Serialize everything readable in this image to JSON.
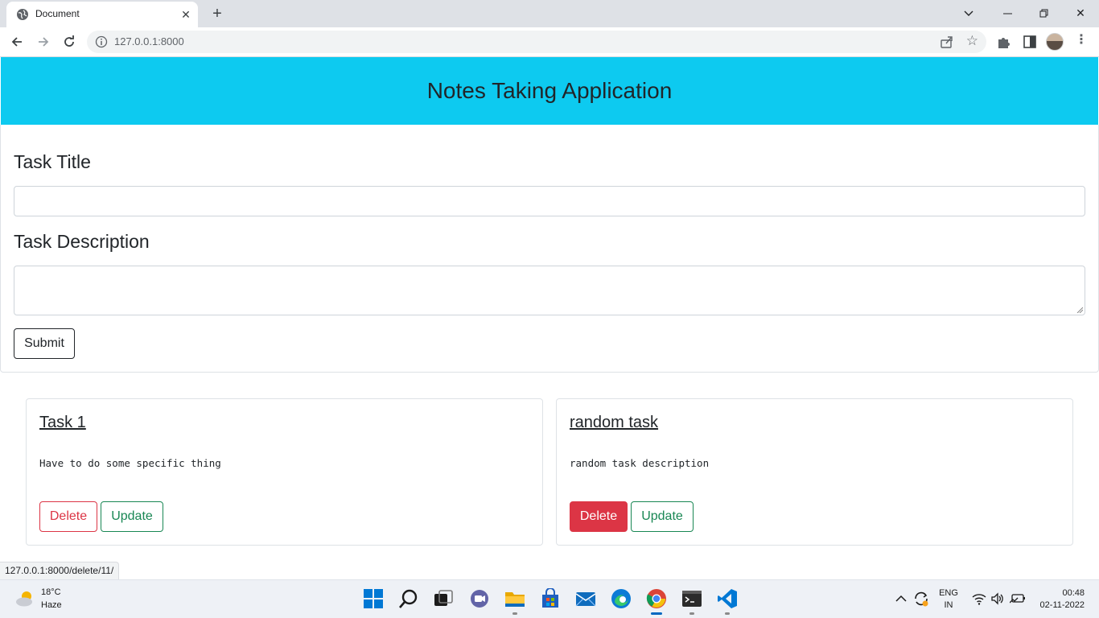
{
  "browser": {
    "tab_title": "Document",
    "url": "127.0.0.1:8000",
    "window_controls": [
      "chevron-down-icon",
      "minimize-icon",
      "restore-icon",
      "close-icon"
    ]
  },
  "page": {
    "header_title": "Notes Taking Application",
    "form": {
      "title_label": "Task Title",
      "title_value": "",
      "description_label": "Task Description",
      "description_value": "",
      "submit_label": "Submit"
    },
    "notes": [
      {
        "title": "Task 1",
        "description": "Have to do some specific thing",
        "delete_label": "Delete",
        "update_label": "Update",
        "delete_style": "outline"
      },
      {
        "title": "random task",
        "description": "random task description",
        "delete_label": "Delete",
        "update_label": "Update",
        "delete_style": "solid-hover"
      }
    ],
    "colors": {
      "header_bg": "#0dcaf0",
      "danger": "#dc3545",
      "success": "#198754"
    }
  },
  "status_bar": {
    "link": "127.0.0.1:8000/delete/11/"
  },
  "taskbar": {
    "weather_temp": "18°C",
    "weather_condition": "Haze",
    "apps": [
      "windows-start-icon",
      "search-icon",
      "task-view-icon",
      "chat-icon",
      "file-explorer-icon",
      "store-icon",
      "mail-icon",
      "edge-icon",
      "chrome-icon",
      "terminal-icon",
      "vscode-icon"
    ],
    "language_line1": "ENG",
    "language_line2": "IN",
    "time": "00:48",
    "date": "02-11-2022"
  }
}
